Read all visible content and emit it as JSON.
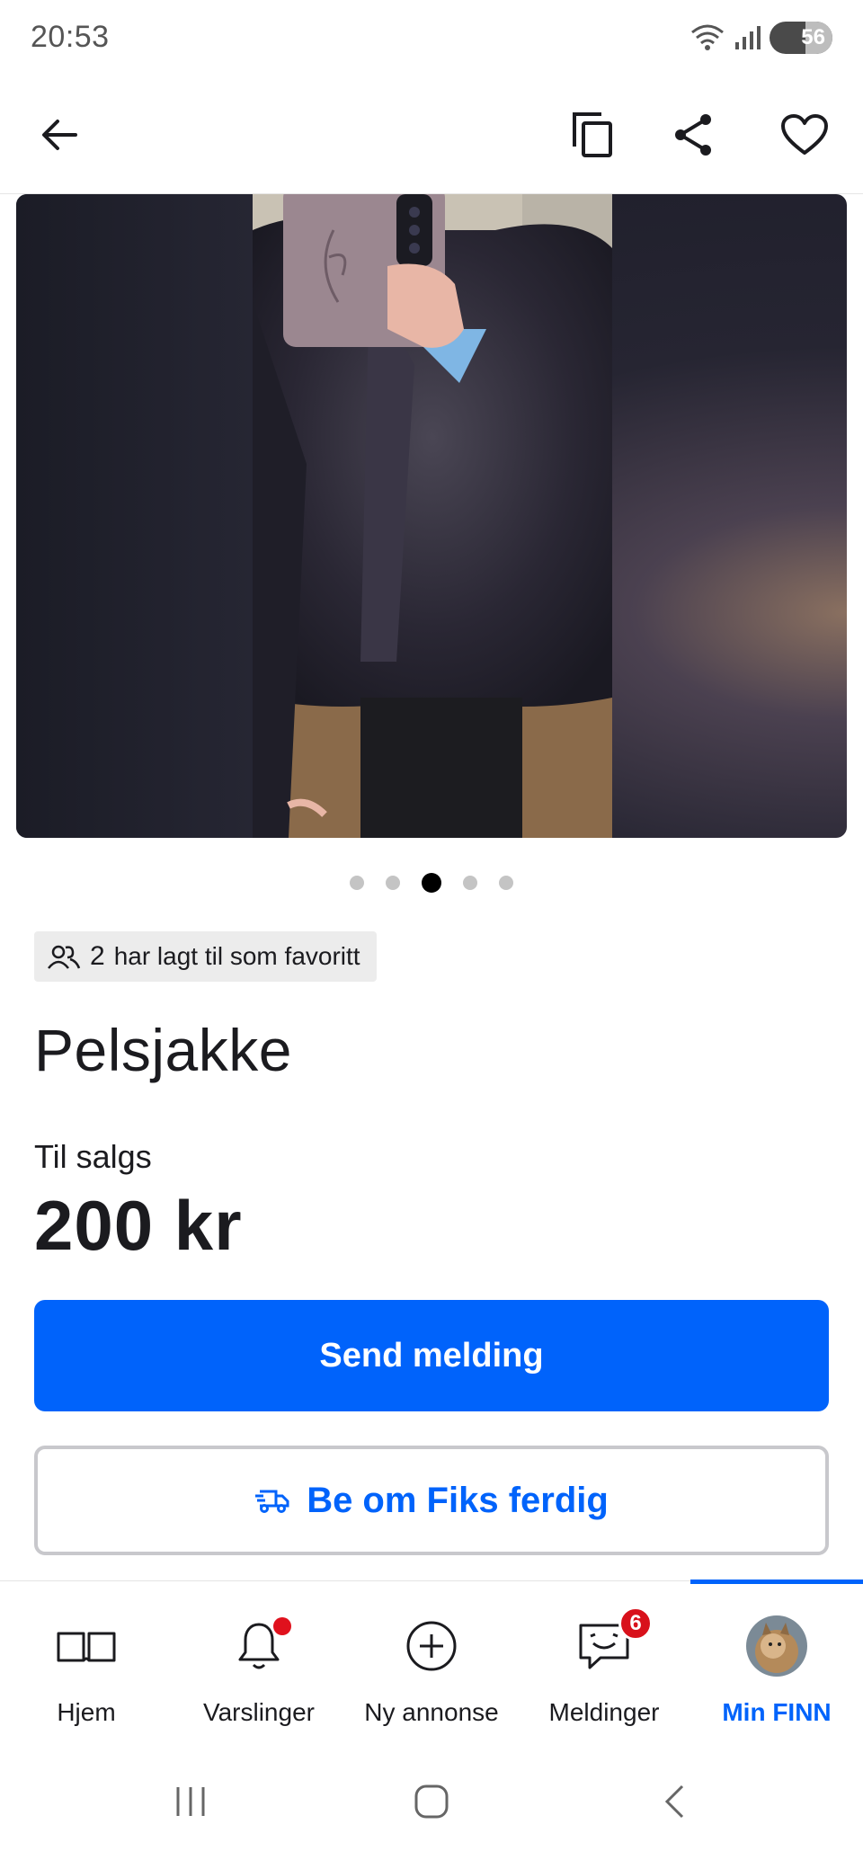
{
  "status_bar": {
    "time": "20:53",
    "battery": "56"
  },
  "header": {
    "back_icon": "arrow-left-icon",
    "actions": [
      "copy-icon",
      "share-icon",
      "heart-icon"
    ]
  },
  "gallery": {
    "image_count": 5,
    "active_index": 2
  },
  "listing": {
    "favorites_count": "2",
    "favorites_text": "har lagt til som favoritt",
    "title": "Pelsjakke",
    "sale_label": "Til salgs",
    "price": "200 kr"
  },
  "actions": {
    "send_message": "Send melding",
    "fiks_ferdig": "Be om Fiks ferdig"
  },
  "bottom_nav": {
    "items": [
      {
        "label": "Hjem",
        "icon": "book-icon"
      },
      {
        "label": "Varslinger",
        "icon": "bell-icon",
        "dot": true
      },
      {
        "label": "Ny annonse",
        "icon": "plus-circle-icon"
      },
      {
        "label": "Meldinger",
        "icon": "chat-icon",
        "badge": "6"
      },
      {
        "label": "Min FINN",
        "icon": "avatar",
        "active": true
      }
    ]
  },
  "colors": {
    "primary": "#0063fb",
    "badge": "#d8111b"
  }
}
